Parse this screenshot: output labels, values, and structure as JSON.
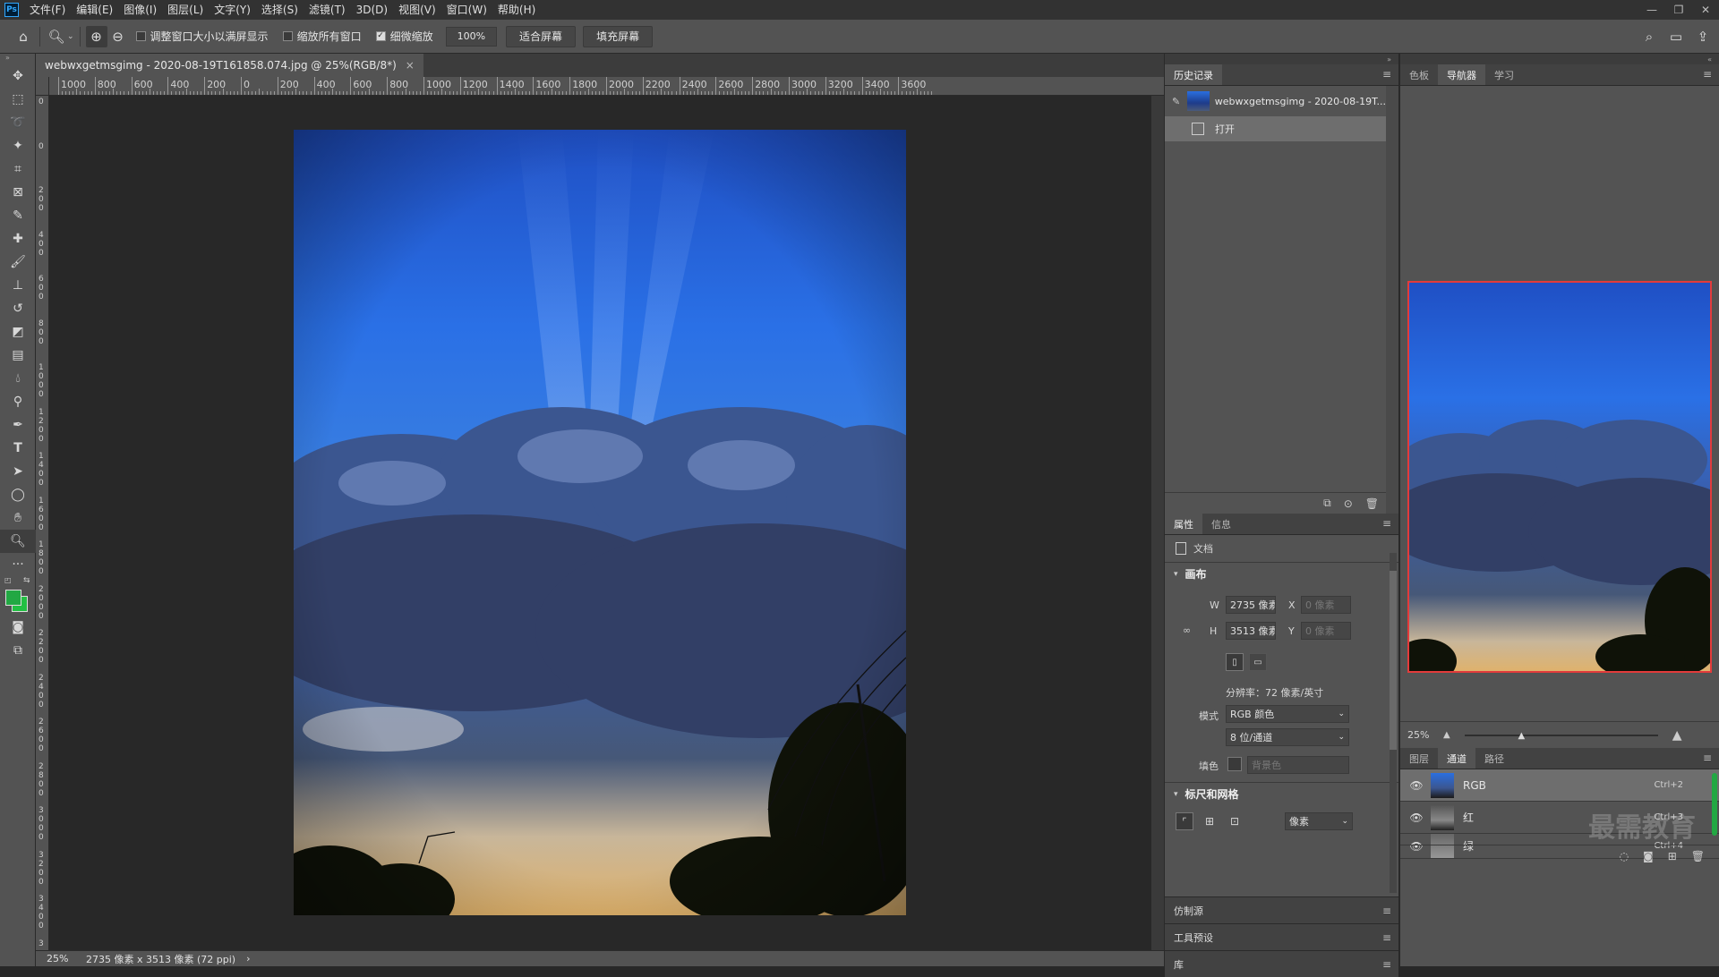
{
  "app": {
    "logo": "Ps"
  },
  "menubar": {
    "items": [
      "文件(F)",
      "编辑(E)",
      "图像(I)",
      "图层(L)",
      "文字(Y)",
      "选择(S)",
      "滤镜(T)",
      "3D(D)",
      "视图(V)",
      "窗口(W)",
      "帮助(H)"
    ]
  },
  "window_controls": {
    "minimize": "—",
    "restore": "❐",
    "close": "✕"
  },
  "options": {
    "resize_windows_label": "调整窗口大小以满屏显示",
    "resize_windows_checked": false,
    "zoom_all_label": "缩放所有窗口",
    "zoom_all_checked": false,
    "scrubby_zoom_label": "细微缩放",
    "scrubby_zoom_checked": true,
    "zoom_value": "100%",
    "fit_screen_label": "适合屏幕",
    "fill_screen_label": "填充屏幕"
  },
  "document": {
    "tab_title": "webwxgetmsgimg - 2020-08-19T161858.074.jpg @ 25%(RGB/8*)",
    "close_glyph": "×"
  },
  "ruler": {
    "h_labels": [
      "1000",
      "800",
      "600",
      "400",
      "200",
      "0",
      "200",
      "400",
      "600",
      "800",
      "1000",
      "1200",
      "1400",
      "1600",
      "1800",
      "2000",
      "2200",
      "2400",
      "2600",
      "2800",
      "3000",
      "3200",
      "3400",
      "3600"
    ],
    "v_labels": [
      "0",
      "0",
      "2 0 0",
      "4 0 0",
      "6 0 0",
      "8 0 0",
      "1 0 0 0",
      "1 2 0 0",
      "1 4 0 0",
      "1 6 0 0",
      "1 8 0 0",
      "2 0 0 0",
      "2 2 0 0",
      "2 4 0 0",
      "2 6 0 0",
      "2 8 0 0",
      "3 0 0 0",
      "3 2 0 0",
      "3 4 0 0",
      "3"
    ]
  },
  "status": {
    "zoom": "25%",
    "doc_info": "2735 像素 x 3513 像素 (72 ppi)",
    "arrow": "›"
  },
  "history_panel": {
    "tab": "历史记录",
    "snapshot_label": "webwxgetmsgimg - 2020-08-19T...",
    "items": [
      {
        "label": "打开"
      }
    ]
  },
  "properties_panel": {
    "tabs": [
      "属性",
      "信息"
    ],
    "doc_label": "文档",
    "canvas_section": "画布",
    "width_label": "W",
    "width_value": "2735 像素",
    "height_label": "H",
    "height_value": "3513 像素",
    "x_label": "X",
    "x_value": "0 像素",
    "y_label": "Y",
    "y_value": "0 像素",
    "resolution": "分辨率：72 像素/英寸",
    "mode_label": "模式",
    "mode_value": "RGB 颜色",
    "depth_value": "8 位/通道",
    "fill_label": "填色",
    "fill_value": "背景色",
    "rulers_grid_section": "标尺和网格",
    "units_value": "像素"
  },
  "mini_panels": {
    "clone_source": "仿制源",
    "tool_presets": "工具预设",
    "library": "库"
  },
  "navigator_panel": {
    "tabs": [
      "色板",
      "导航器",
      "学习"
    ],
    "zoom": "25%",
    "zoom_level_fraction": 0.3
  },
  "channels_panel": {
    "tabs": [
      "图层",
      "通道",
      "路径"
    ],
    "channels": [
      {
        "name": "RGB",
        "shortcut": "Ctrl+2"
      },
      {
        "name": "红",
        "shortcut": "Ctrl+3"
      },
      {
        "name": "绿",
        "shortcut": "Ctrl+4"
      }
    ]
  },
  "watermark": "最需教育",
  "colors": {
    "foreground": "#22a843",
    "background": "#22c043",
    "nav_view_box": "#e33b3b"
  }
}
